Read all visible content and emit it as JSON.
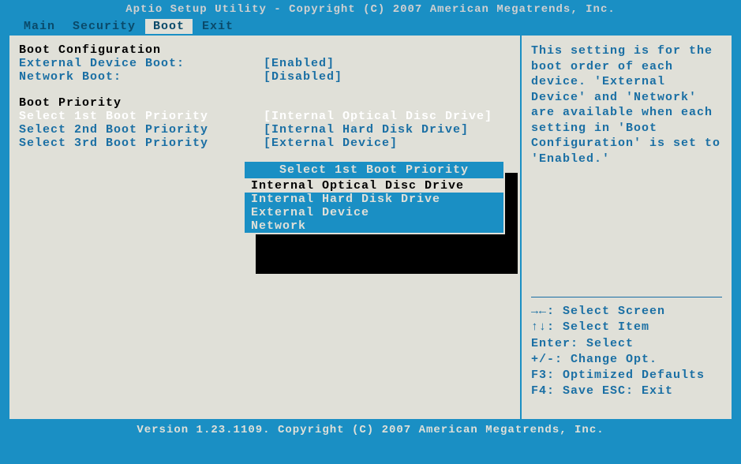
{
  "header": {
    "title": "Aptio Setup Utility - Copyright (C) 2007 American Megatrends, Inc."
  },
  "tabs": {
    "items": [
      {
        "label": "Main",
        "active": false
      },
      {
        "label": "Security",
        "active": false
      },
      {
        "label": "Boot",
        "active": true
      },
      {
        "label": "Exit",
        "active": false
      }
    ]
  },
  "boot_config": {
    "header": "Boot Configuration",
    "external_device_label": "External Device Boot:",
    "external_device_value": "[Enabled]",
    "network_boot_label": "Network Boot:",
    "network_boot_value": "[Disabled]"
  },
  "boot_priority": {
    "header": "Boot Priority",
    "first_label": "Select 1st Boot Priority",
    "first_value": "[Internal Optical Disc Drive]",
    "second_label": "Select 2nd Boot Priority",
    "second_value": "[Internal Hard Disk Drive]",
    "third_label": "Select 3rd Boot Priority",
    "third_value": "[External Device]"
  },
  "popup": {
    "title": "Select 1st Boot Priority",
    "options": [
      {
        "label": "Internal Optical Disc Drive",
        "selected": true
      },
      {
        "label": "Internal Hard Disk Drive",
        "selected": false
      },
      {
        "label": "External Device",
        "selected": false
      },
      {
        "label": "Network",
        "selected": false
      }
    ]
  },
  "help": {
    "text": "This setting is for the boot order of each device. 'External Device' and 'Network' are available when each setting in 'Boot Configuration' is set to 'Enabled.'"
  },
  "key_hints": {
    "line1": "→←: Select Screen",
    "line2": "↑↓: Select Item",
    "line3": "Enter: Select",
    "line4": "+/-: Change Opt.",
    "line5": "F3: Optimized Defaults",
    "line6": "F4: Save  ESC: Exit"
  },
  "footer": {
    "text": "Version 1.23.1109. Copyright (C) 2007 American Megatrends, Inc."
  }
}
